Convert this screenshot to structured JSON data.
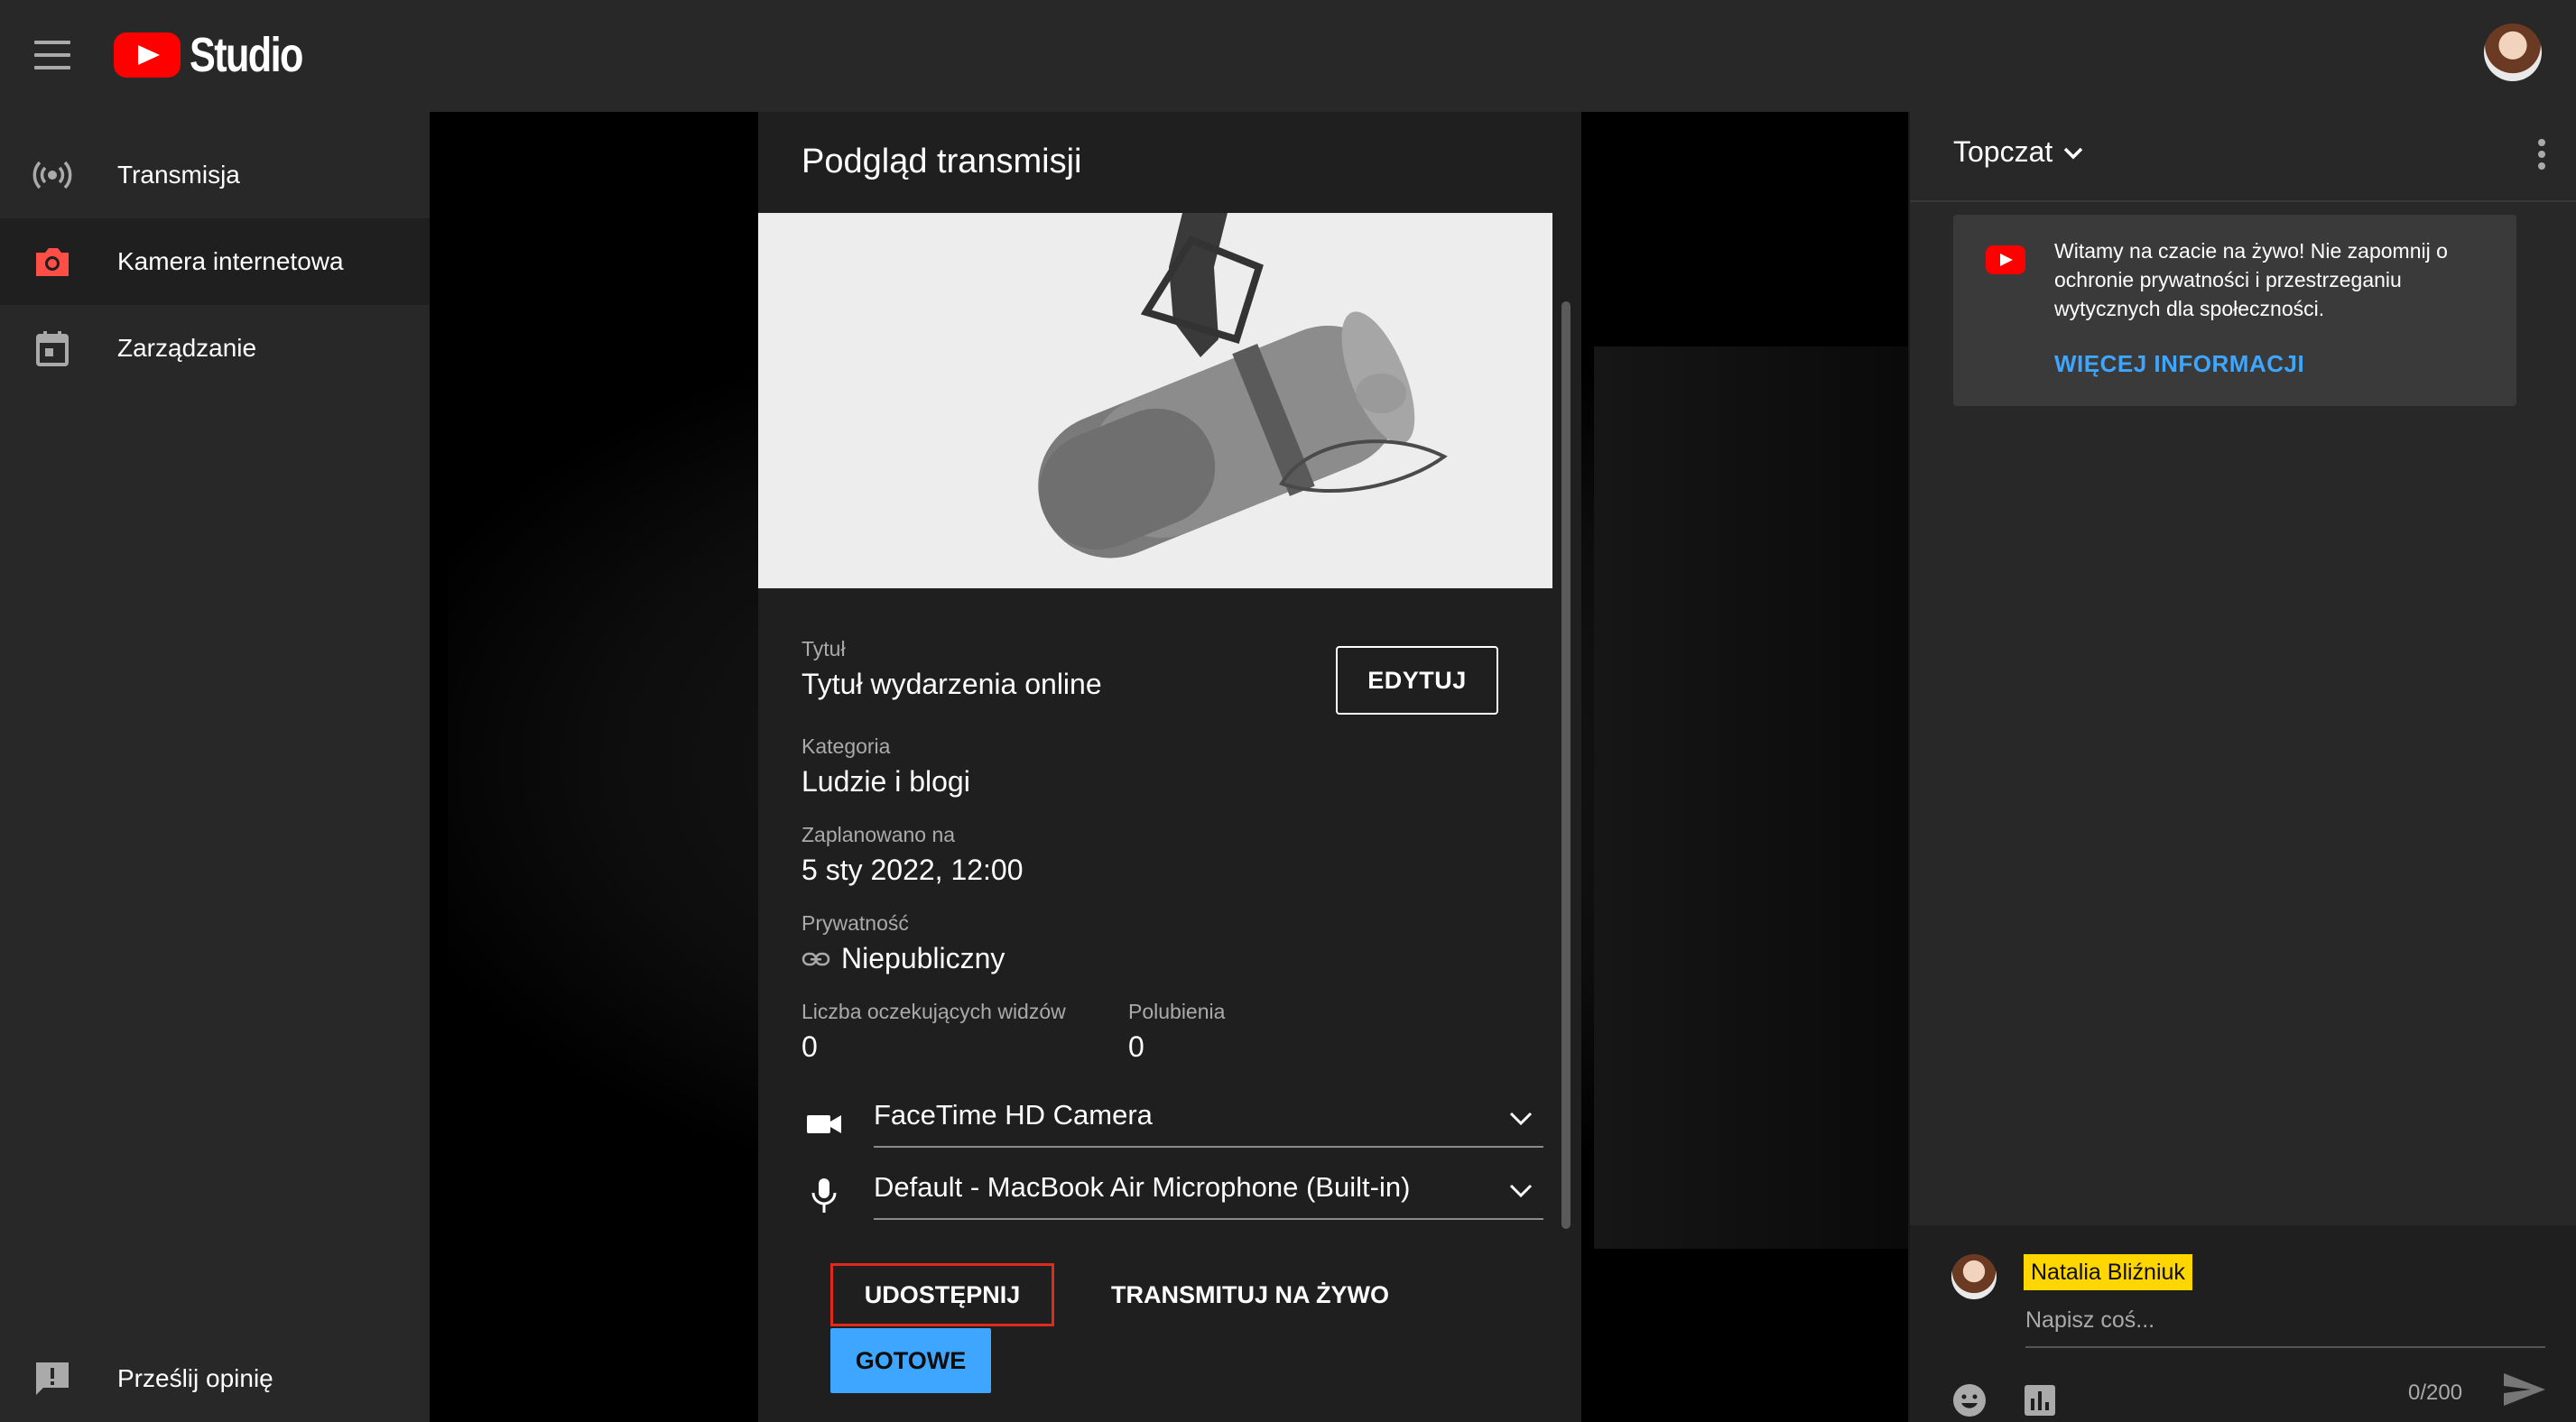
{
  "header": {
    "app_title": "Studio"
  },
  "sidebar": {
    "items": [
      {
        "label": "Transmisja",
        "icon": "live-broadcast-icon"
      },
      {
        "label": "Kamera internetowa",
        "icon": "camera-icon"
      },
      {
        "label": "Zarządzanie",
        "icon": "calendar-icon"
      }
    ],
    "feedback_label": "Prześlij opinię"
  },
  "panel": {
    "title": "Podgląd transmisji",
    "title_label": "Tytuł",
    "title_value": "Tytuł wydarzenia online",
    "edit_label": "EDYTUJ",
    "category_label": "Kategoria",
    "category_value": "Ludzie i blogi",
    "scheduled_label": "Zaplanowano na",
    "scheduled_value": "5 sty 2022, 12:00",
    "privacy_label": "Prywatność",
    "privacy_value": "Niepubliczny",
    "waiting_label": "Liczba oczekujących widzów",
    "waiting_value": "0",
    "likes_label": "Polubienia",
    "likes_value": "0",
    "camera_value": "FaceTime HD Camera",
    "microphone_value": "Default - MacBook Air Microphone (Built-in)",
    "share_label": "UDOSTĘPNIJ",
    "golive_label": "TRANSMITUJ NA ŻYWO",
    "done_label": "GOTOWE"
  },
  "chat": {
    "title": "Topczat",
    "welcome_text": "Witamy na czacie na żywo! Nie zapomnij o ochronie prywatności i przestrzeganiu wytycznych dla społeczności.",
    "welcome_link": "WIĘCEJ INFORMACJI",
    "user_name": "Natalia Bliźniuk",
    "input_placeholder": "Napisz coś...",
    "counter": "0/200"
  },
  "colors": {
    "accent_blue": "#3ea6ff",
    "youtube_red": "#ff0000",
    "highlight_red": "#e02a1b",
    "name_badge": "#ffd600"
  }
}
